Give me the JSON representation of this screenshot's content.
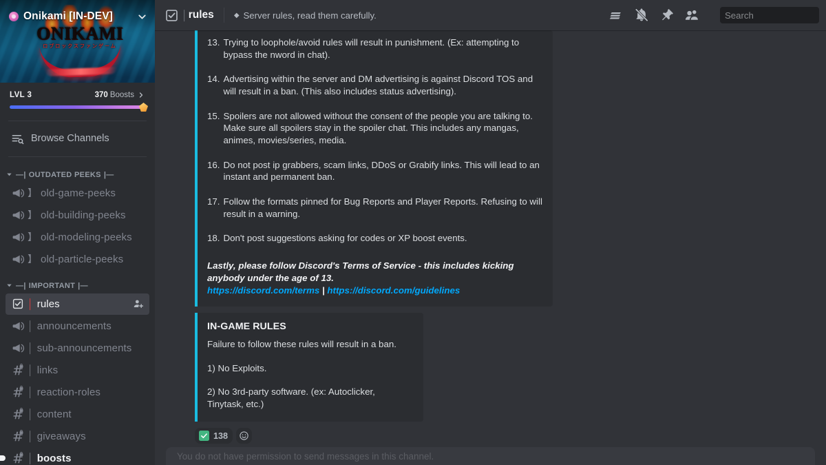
{
  "server": {
    "name": "Onikami [IN-DEV]",
    "verified_icon": "verified-server-badge",
    "banner_title": "ONIKAMI",
    "banner_subtitle": "ロブロックスファンゲーム",
    "boost_level": "LVL 3",
    "boost_count": "370",
    "boost_label": "Boosts",
    "boost_progress_pct": 100
  },
  "sidebar": {
    "browse_channels": "Browse Channels",
    "categories": [
      {
        "name": "OUTDATED PEEKS",
        "prefix": "—|",
        "suffix": "|—",
        "channels": [
          {
            "name": "old-game-peeks",
            "icon": "announcement-channel-icon",
            "bracket": "】",
            "state": "normal"
          },
          {
            "name": "old-building-peeks",
            "icon": "announcement-channel-icon",
            "bracket": "】",
            "state": "normal"
          },
          {
            "name": "old-modeling-peeks",
            "icon": "announcement-channel-icon",
            "bracket": "】",
            "state": "normal"
          },
          {
            "name": "old-particle-peeks",
            "icon": "announcement-channel-icon",
            "bracket": "】",
            "state": "normal"
          }
        ]
      },
      {
        "name": "IMPORTANT",
        "prefix": "—|",
        "suffix": "|—",
        "channels": [
          {
            "name": "rules",
            "icon": "rules-channel-icon",
            "bracket": "│",
            "state": "active",
            "action_icon": "invite-member-icon"
          },
          {
            "name": "announcements",
            "icon": "announcement-channel-icon",
            "bracket": "│",
            "state": "normal"
          },
          {
            "name": "sub-announcements",
            "icon": "announcement-channel-icon",
            "bracket": "│",
            "state": "normal"
          },
          {
            "name": "links",
            "icon": "locked-text-channel-icon",
            "bracket": "│",
            "state": "normal"
          },
          {
            "name": "reaction-roles",
            "icon": "locked-text-channel-icon",
            "bracket": "│",
            "state": "normal"
          },
          {
            "name": "content",
            "icon": "locked-text-channel-icon",
            "bracket": "│",
            "state": "normal"
          },
          {
            "name": "giveaways",
            "icon": "locked-text-channel-icon",
            "bracket": "│",
            "state": "normal"
          },
          {
            "name": "boosts",
            "icon": "locked-text-channel-icon",
            "bracket": "│",
            "state": "unread"
          }
        ]
      }
    ]
  },
  "topbar": {
    "channel_icon": "rules-channel-icon",
    "channel_bracket": "│",
    "channel_name": "rules",
    "topic_icon": "◆",
    "topic": "Server rules, read them carefully.",
    "actions": [
      {
        "name": "threads-icon"
      },
      {
        "name": "notifications-muted-icon"
      },
      {
        "name": "pinned-messages-icon"
      },
      {
        "name": "member-list-icon"
      }
    ],
    "search_placeholder": "Search"
  },
  "message": {
    "embeds": [
      {
        "accent_color": "#1abce0",
        "rules": [
          {
            "num": "13.",
            "text": "Trying to loophole/avoid rules will result in punishment. (Ex: attempting to bypass the nword in chat)."
          },
          {
            "num": "14.",
            "text": "Advertising within the server and DM advertising is against Discord TOS and will result in a ban. (This also includes status advertising)."
          },
          {
            "num": "15.",
            "text": "Spoilers are not allowed without the consent of the people you are talking to. Make sure all spoilers stay in the spoiler chat. This includes any mangas, animes, movies/series, media."
          },
          {
            "num": "16.",
            "text": "Do not post ip grabbers, scam links, DDoS or Grabify links. This will lead to an instant and permanent ban."
          },
          {
            "num": "17.",
            "text": "Follow the formats pinned for Bug Reports and Player Reports. Refusing to will result in a warning."
          },
          {
            "num": "18.",
            "text": "Don't post suggestions asking for codes or XP boost events."
          }
        ],
        "closing": "Lastly, please follow Discord's Terms of Service - this includes kicking anybody under the age of 13.",
        "link_1": "https://discord.com/terms",
        "link_separator": " | ",
        "link_2": "https://discord.com/guidelines"
      },
      {
        "accent_color": "#1abce0",
        "title": "IN-GAME RULES",
        "lines": [
          "Failure to follow these rules will result in a ban.",
          "1) No Exploits.",
          "2) No 3rd-party software. (ex: Autoclicker, Tinytask, etc.)"
        ]
      }
    ],
    "reaction": {
      "emoji_name": "white-check-mark-emoji",
      "emoji_glyph": "✔",
      "count": "138"
    },
    "add_reaction_icon": "add-reaction-icon"
  },
  "compose": {
    "disabled_text": "You do not have permission to send messages in this channel."
  },
  "colors": {
    "sidebar_bg": "#2b2d31",
    "chat_bg": "#313338",
    "embed_bg": "#2b2d31",
    "embed_accent": "#1abce0",
    "link": "#00a8fc",
    "active_channel_bg": "#404249",
    "boost_bar_start": "#4a6ef5",
    "boost_bar_end": "#dd86e6",
    "reaction_emoji_bg": "#43b581"
  }
}
